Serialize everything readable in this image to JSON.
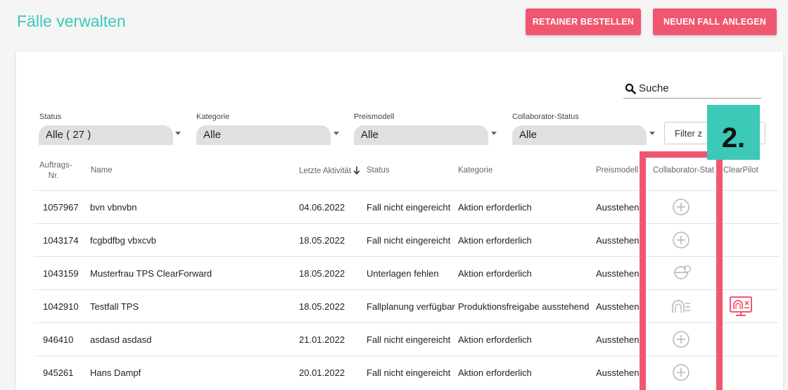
{
  "header": {
    "title": "Fälle verwalten",
    "retainer_button": "RETAINER BESTELLEN",
    "new_case_button": "NEUEN FALL ANLEGEN"
  },
  "search": {
    "label": "Suche"
  },
  "filters": {
    "status": {
      "label": "Status",
      "value": "Alle ( 27 )"
    },
    "kategorie": {
      "label": "Kategorie",
      "value": "Alle"
    },
    "preismodell": {
      "label": "Preismodell",
      "value": "Alle"
    },
    "collaborator": {
      "label": "Collaborator-Status",
      "value": "Alle"
    },
    "text_filter": {
      "value": "Filter z"
    }
  },
  "table": {
    "headers": {
      "nr_line1": "Auftrags-",
      "nr_line2": "Nr.",
      "name": "Name",
      "letzte_aktivitaet": "Letzte Aktivität",
      "status": "Status",
      "kategorie": "Kategorie",
      "preismodell": "Preismodell",
      "collaborator": "Collaborator-Stat",
      "clearpilot": "ClearPilot"
    },
    "rows": [
      {
        "nr": "1057967",
        "name": "bvn vbnvbn",
        "date": "04.06.2022",
        "status": "Fall nicht eingereicht",
        "kategorie": "Aktion erforderlich",
        "preis": "Ausstehen",
        "collab_icon": "plus-circle-icon",
        "clearpilot": false
      },
      {
        "nr": "1043174",
        "name": "fcgbdfbg vbxcvb",
        "date": "18.05.2022",
        "status": "Fall nicht eingereicht",
        "kategorie": "Aktion erforderlich",
        "preis": "Ausstehen",
        "collab_icon": "plus-circle-icon",
        "clearpilot": false
      },
      {
        "nr": "1043159",
        "name": "Musterfrau TPS ClearForward",
        "date": "18.05.2022",
        "status": "Unterlagen fehlen",
        "kategorie": "Aktion erforderlich",
        "preis": "Ausstehen",
        "collab_icon": "aligner-chat-icon",
        "clearpilot": false
      },
      {
        "nr": "1042910",
        "name": "Testfall TPS",
        "date": "18.05.2022",
        "status": "Fallplanung verfügbar",
        "kategorie": "Produktionsfreigabe ausstehend",
        "preis": "Ausstehen",
        "collab_icon": "aligner-list-icon",
        "clearpilot": true
      },
      {
        "nr": "946410",
        "name": "asdasd asdasd",
        "date": "21.01.2022",
        "status": "Fall nicht eingereicht",
        "kategorie": "Aktion erforderlich",
        "preis": "Ausstehen",
        "collab_icon": "plus-circle-icon",
        "clearpilot": false
      },
      {
        "nr": "945261",
        "name": "Hans Dampf",
        "date": "20.01.2022",
        "status": "Fall nicht eingereicht",
        "kategorie": "Aktion erforderlich",
        "preis": "Ausstehen",
        "collab_icon": "plus-circle-icon",
        "clearpilot": false
      }
    ]
  },
  "annotation": {
    "badge": "2."
  },
  "colors": {
    "accent": "#3cc9b8",
    "primary": "#f05670",
    "icon_gray": "#b5b5b5"
  }
}
